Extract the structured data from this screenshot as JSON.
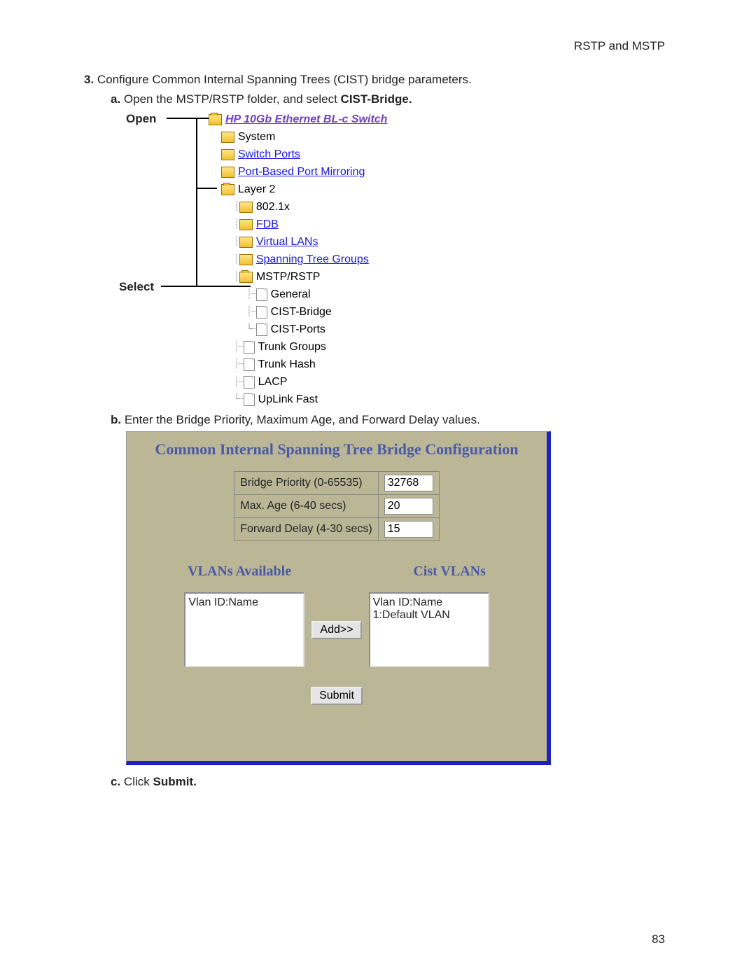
{
  "header": {
    "section": "RSTP and MSTP",
    "page_number": "83"
  },
  "steps": {
    "num3": "3.",
    "text3": "Configure Common Internal Spanning Trees (CIST) bridge parameters.",
    "a_label": "a.",
    "a_text_pre": "Open the MSTP/RSTP folder, and select ",
    "a_text_bold": "CIST-Bridge.",
    "b_label": "b.",
    "b_text": "Enter the Bridge Priority, Maximum Age, and Forward Delay values.",
    "c_label": "c.",
    "c_text_pre": "Click ",
    "c_text_bold": "Submit."
  },
  "annot": {
    "open": "Open",
    "select": "Select"
  },
  "tree": {
    "root": "HP 10Gb Ethernet BL-c Switch",
    "system": "System",
    "switch_ports": "Switch Ports",
    "port_mirror": "Port-Based Port Mirroring",
    "layer2": "Layer 2",
    "dot1x": "802.1x",
    "fdb": "FDB",
    "vlans": "Virtual LANs",
    "stg": "Spanning Tree Groups",
    "mstp": "MSTP/RSTP",
    "general": "General",
    "cist_bridge": "CIST-Bridge",
    "cist_ports": "CIST-Ports",
    "trunk_groups": "Trunk Groups",
    "trunk_hash": "Trunk Hash",
    "lacp": "LACP",
    "uplink": "UpLink Fast"
  },
  "form": {
    "title": "Common Internal Spanning Tree Bridge Configuration",
    "row1_label": "Bridge Priority (0-65535)",
    "row1_val": "32768",
    "row2_label": "Max. Age (6-40 secs)",
    "row2_val": "20",
    "row3_label": "Forward Delay (4-30 secs)",
    "row3_val": "15",
    "vlans_avail": "VLANs Available",
    "cist_vlans": "Cist VLANs",
    "left_header": "Vlan ID:Name",
    "right_l1": "Vlan ID:Name",
    "right_l2": "1:Default VLAN",
    "add_btn": "Add>>",
    "submit_btn": "Submit"
  }
}
